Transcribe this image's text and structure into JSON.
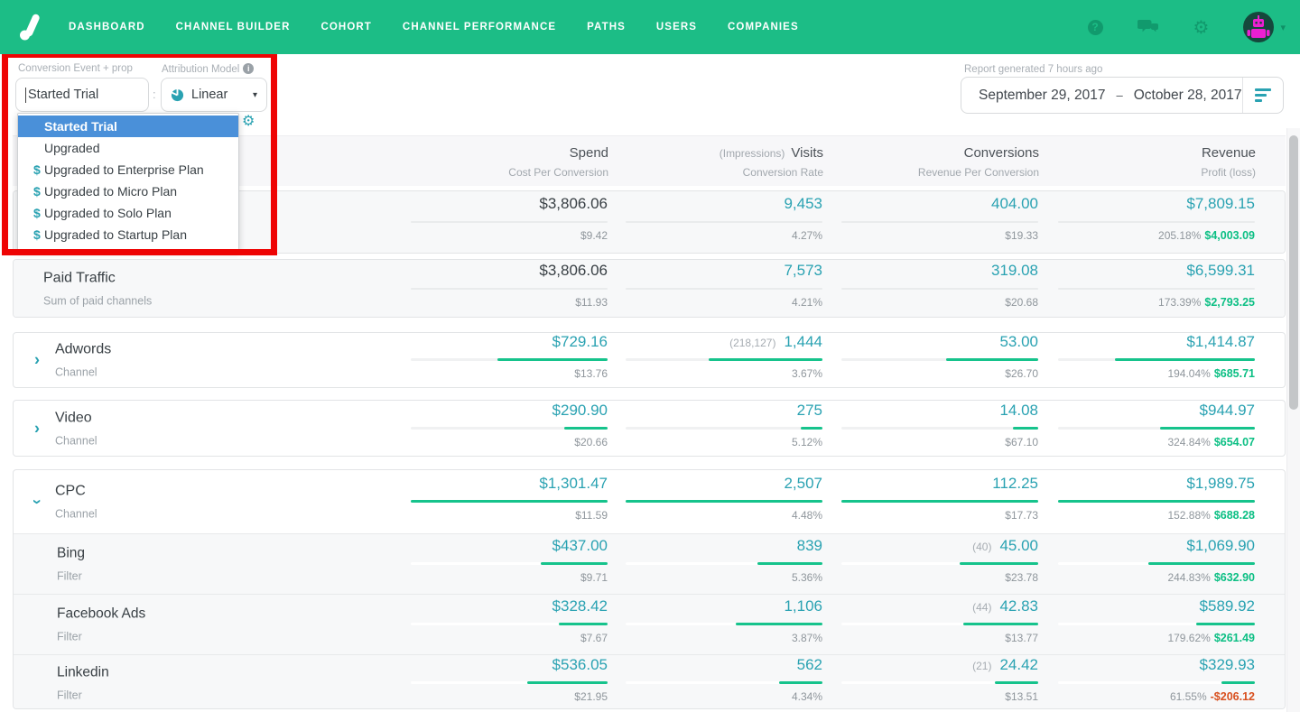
{
  "nav": {
    "items": [
      "DASHBOARD",
      "CHANNEL BUILDER",
      "COHORT",
      "CHANNEL PERFORMANCE",
      "PATHS",
      "USERS",
      "COMPANIES"
    ],
    "help_glyph": "?",
    "gear_glyph": "⚙",
    "caret_glyph": "▾"
  },
  "controls": {
    "conversion_event_label": "Conversion Event  + prop",
    "conversion_event_value": "Started Trial",
    "colon": ":",
    "attribution_model_label": "Attribution Model",
    "info_glyph": "i",
    "attribution_model_value": "Linear",
    "model_caret": "▾",
    "settings_gear": "⚙"
  },
  "dropdown": {
    "items": [
      {
        "prefix": "",
        "label": "Started Trial"
      },
      {
        "prefix": "",
        "label": "Upgraded"
      },
      {
        "prefix": "$",
        "label": "Upgraded to Enterprise Plan"
      },
      {
        "prefix": "$",
        "label": "Upgraded to Micro Plan"
      },
      {
        "prefix": "$",
        "label": "Upgraded to Solo Plan"
      },
      {
        "prefix": "$",
        "label": "Upgraded to Startup Plan"
      }
    ]
  },
  "report": {
    "generated_label": "Report generated 7 hours ago",
    "date_start": "September 29, 2017",
    "date_separator": "–",
    "date_end": "October 28, 2017"
  },
  "colors": {
    "nav_green": "#1cbd86",
    "teal_value": "#2aa2b2",
    "bar_green": "#16c38c",
    "profit_green": "#0cbf84",
    "loss_red": "#d8501f",
    "selection_blue": "#4a90d9",
    "annotation_red": "#ee0404"
  },
  "table": {
    "header": {
      "spend": "Spend",
      "spend_sub": "Cost Per Conversion",
      "visits_pre": "(Impressions)",
      "visits": "Visits",
      "visits_sub": "Conversion Rate",
      "conversions": "Conversions",
      "conversions_sub": "Revenue Per Conversion",
      "revenue": "Revenue",
      "revenue_sub": "Profit (loss)"
    },
    "rows": [
      {
        "name": "",
        "type": "",
        "spend": "$3,806.06",
        "cpc": "$9.42",
        "visits": "9,453",
        "rate": "4.27%",
        "conversions": "404.00",
        "rpc": "$19.33",
        "revenue": "$7,809.15",
        "roi": "205.18%",
        "profit": "$4,003.09"
      },
      {
        "name": "Paid Traffic",
        "type": "Sum of paid channels",
        "spend": "$3,806.06",
        "cpc": "$11.93",
        "visits": "7,573",
        "rate": "4.21%",
        "conversions": "319.08",
        "rpc": "$20.68",
        "revenue": "$6,599.31",
        "roi": "173.39%",
        "profit": "$2,793.25"
      },
      {
        "name": "Adwords",
        "type": "Channel",
        "spend": "$729.16",
        "cpc": "$13.76",
        "impressions": "(218,127)",
        "visits": "1,444",
        "rate": "3.67%",
        "conversions": "53.00",
        "rpc": "$26.70",
        "revenue": "$1,414.87",
        "roi": "194.04%",
        "profit": "$685.71",
        "bars": {
          "spend": "56%",
          "visits": "58%",
          "conversions": "47%",
          "revenue": "71%"
        }
      },
      {
        "name": "Video",
        "type": "Channel",
        "spend": "$290.90",
        "cpc": "$20.66",
        "visits": "275",
        "rate": "5.12%",
        "conversions": "14.08",
        "rpc": "$67.10",
        "revenue": "$944.97",
        "roi": "324.84%",
        "profit": "$654.07",
        "bars": {
          "spend": "22%",
          "visits": "11%",
          "conversions": "13%",
          "revenue": "48%"
        }
      },
      {
        "name": "CPC",
        "type": "Channel",
        "spend": "$1,301.47",
        "cpc": "$11.59",
        "visits": "2,507",
        "rate": "4.48%",
        "conversions": "112.25",
        "rpc": "$17.73",
        "revenue": "$1,989.75",
        "roi": "152.88%",
        "profit": "$688.28",
        "bars": {
          "spend": "100%",
          "visits": "100%",
          "conversions": "100%",
          "revenue": "100%"
        }
      },
      {
        "name": "Bing",
        "type": "Filter",
        "spend": "$437.00",
        "cpc": "$9.71",
        "visits": "839",
        "rate": "5.36%",
        "assists": "(40)",
        "conversions": "45.00",
        "rpc": "$23.78",
        "revenue": "$1,069.90",
        "roi": "244.83%",
        "profit": "$632.90",
        "bars": {
          "spend": "34%",
          "visits": "33%",
          "conversions": "40%",
          "revenue": "54%"
        }
      },
      {
        "name": "Facebook Ads",
        "type": "Filter",
        "spend": "$328.42",
        "cpc": "$7.67",
        "visits": "1,106",
        "rate": "3.87%",
        "assists": "(44)",
        "conversions": "42.83",
        "rpc": "$13.77",
        "revenue": "$589.92",
        "roi": "179.62%",
        "profit": "$261.49",
        "bars": {
          "spend": "25%",
          "visits": "44%",
          "conversions": "38%",
          "revenue": "30%"
        }
      },
      {
        "name": "Linkedin",
        "type": "Filter",
        "spend": "$536.05",
        "cpc": "$21.95",
        "visits": "562",
        "rate": "4.34%",
        "assists": "(21)",
        "conversions": "24.42",
        "rpc": "$13.51",
        "revenue": "$329.93",
        "roi": "61.55%",
        "profit": "-$206.12",
        "bars": {
          "spend": "41%",
          "visits": "22%",
          "conversions": "22%",
          "revenue": "17%"
        }
      }
    ]
  }
}
